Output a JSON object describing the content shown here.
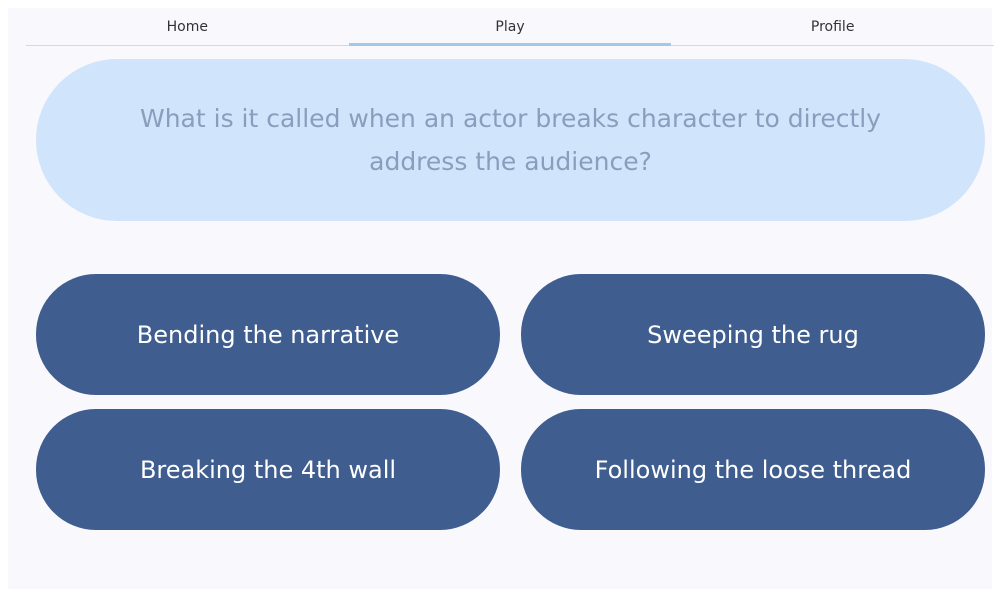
{
  "nav": {
    "tabs": [
      {
        "label": "Home"
      },
      {
        "label": "Play"
      },
      {
        "label": "Profile"
      }
    ],
    "active_tab": "Play"
  },
  "quiz": {
    "question": "What is it called when an actor breaks character to directly address the audience?",
    "answers": [
      {
        "label": "Bending the narrative"
      },
      {
        "label": "Sweeping the rug"
      },
      {
        "label": "Breaking the 4th wall"
      },
      {
        "label": "Following the loose thread"
      }
    ]
  },
  "colors": {
    "question_bg": "#d0e4fc",
    "question_text": "#8b9dbd",
    "answer_bg": "#3f5d8f",
    "active_tab_indicator": "#a3c9ea",
    "page_bg": "#f9f8fd"
  }
}
